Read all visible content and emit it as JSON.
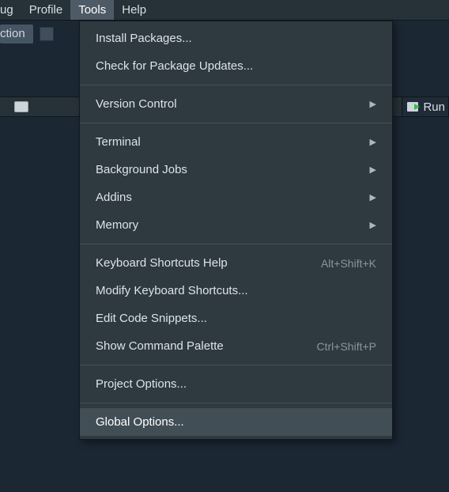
{
  "menubar": {
    "debug_partial": "ug",
    "profile": "Profile",
    "tools": "Tools",
    "help": "Help"
  },
  "secondbar": {
    "ction_partial": "ction"
  },
  "bottombar": {
    "run_partial": "Run"
  },
  "tools_menu": {
    "install_packages": "Install Packages...",
    "check_updates": "Check for Package Updates...",
    "version_control": "Version Control",
    "terminal": "Terminal",
    "background_jobs": "Background Jobs",
    "addins": "Addins",
    "memory": "Memory",
    "keyboard_help": "Keyboard Shortcuts Help",
    "keyboard_help_shortcut": "Alt+Shift+K",
    "modify_keyboard": "Modify Keyboard Shortcuts...",
    "edit_snippets": "Edit Code Snippets...",
    "command_palette": "Show Command Palette",
    "command_palette_shortcut": "Ctrl+Shift+P",
    "project_options": "Project Options...",
    "global_options": "Global Options..."
  }
}
